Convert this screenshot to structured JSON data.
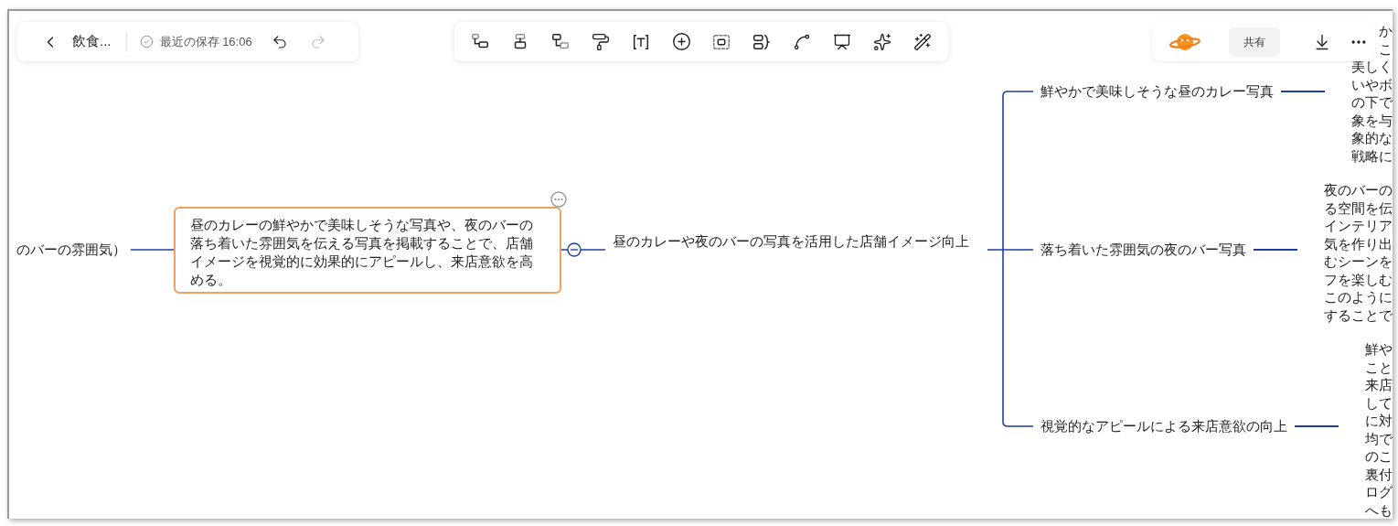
{
  "header": {
    "title": "飲食...",
    "save_status": "最近の保存 16:06",
    "undo": {
      "disabled": false
    },
    "redo": {
      "disabled": true
    }
  },
  "share_button": "共有",
  "mindmap": {
    "parent_node": "のバーの雰囲気）",
    "selected_node": {
      "text": "昼のカレーの鮮やかで美味しそうな写真や、夜のバーの落ち着いた雰囲気を伝える写真を掲載することで、店舗イメージを視覚的に効果的にアピールし、来店意欲を高める。",
      "selected": true,
      "has_comment": true
    },
    "branch": {
      "text": "昼のカレーや夜のバーの写真を活用した店舗イメージ向上",
      "expanded": true,
      "children": [
        {
          "text": "鮮やかで美味しそうな昼のカレー写真",
          "detail_lines": [
            "か",
            "こ",
            "美しく",
            "いやボ",
            "の下で",
            "象を与",
            "象的な",
            "戦略に"
          ]
        },
        {
          "text": "落ち着いた雰囲気の夜のバー写真",
          "detail_lines": [
            "夜のバーの",
            "る空間を伝",
            "インテリア",
            "気を作り出",
            "むシーンを",
            "フを楽しむ",
            "このように",
            "することで"
          ]
        },
        {
          "text": "視覚的なアピールによる来店意欲の向上",
          "detail_lines": [
            "鮮や",
            "こと",
            "来店",
            "して",
            "に対",
            "均で",
            "のこ",
            "裏付",
            "ログ",
            "へも"
          ]
        }
      ]
    }
  }
}
